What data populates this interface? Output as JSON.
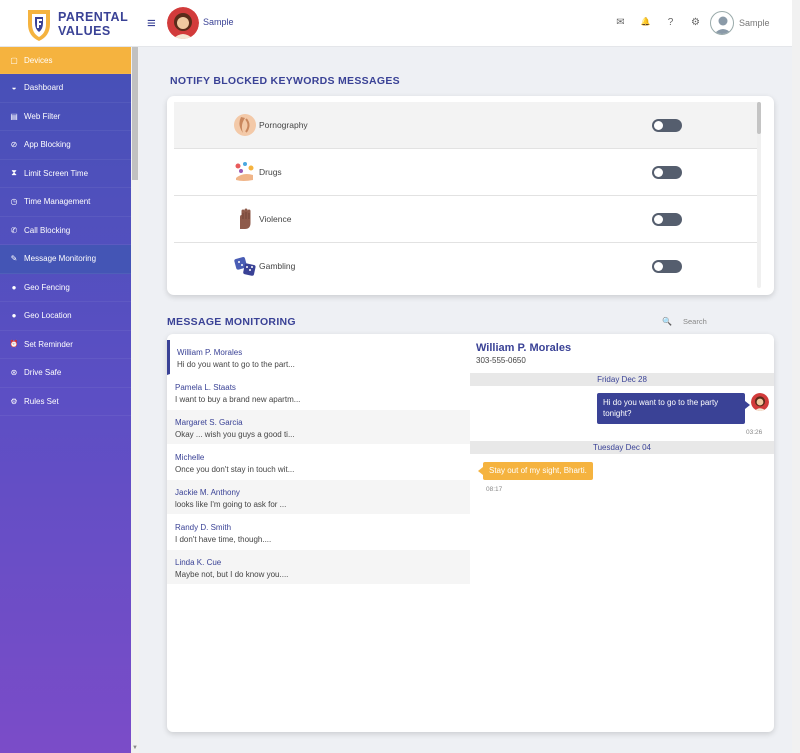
{
  "brand": {
    "line1": "PARENTAL",
    "line2": "VALUES",
    "colors": {
      "primary": "#3a4296",
      "accent": "#f5b33f"
    }
  },
  "header": {
    "menu_icon": "hamburger-icon",
    "profile_name": "Sample",
    "icons": [
      "mail-icon",
      "bell-icon",
      "help-icon",
      "gear-icon"
    ],
    "icon_glyphs": [
      "✉",
      "🔔",
      "?",
      "⚙"
    ],
    "user_name": "Sample"
  },
  "sidebar": {
    "items": [
      {
        "label": "Devices",
        "icon": "device-icon",
        "glyph": "▢"
      },
      {
        "label": "Dashboard",
        "icon": "dashboard-icon",
        "glyph": "◒"
      },
      {
        "label": "Web Filter",
        "icon": "web-filter-icon",
        "glyph": "▤"
      },
      {
        "label": "App Blocking",
        "icon": "block-icon",
        "glyph": "⊘"
      },
      {
        "label": "Limit Screen Time",
        "icon": "hourglass-icon",
        "glyph": "⧗"
      },
      {
        "label": "Time Management",
        "icon": "clock-icon",
        "glyph": "◷"
      },
      {
        "label": "Call Blocking",
        "icon": "phone-icon",
        "glyph": "✆"
      },
      {
        "label": "Message Monitoring",
        "icon": "message-icon",
        "glyph": "✎"
      },
      {
        "label": "Geo Fencing",
        "icon": "globe-icon",
        "glyph": "●"
      },
      {
        "label": "Geo Location",
        "icon": "location-pin-icon",
        "glyph": "●"
      },
      {
        "label": "Set Reminder",
        "icon": "alarm-icon",
        "glyph": "⏰"
      },
      {
        "label": "Drive Safe",
        "icon": "steering-icon",
        "glyph": "⊛"
      },
      {
        "label": "Rules Set",
        "icon": "rules-icon",
        "glyph": "⚙"
      }
    ]
  },
  "keywords": {
    "title": "NOTIFY BLOCKED KEYWORDS MESSAGES",
    "items": [
      {
        "label": "Pornography",
        "icon": "pornography-icon",
        "enabled": false
      },
      {
        "label": "Drugs",
        "icon": "drugs-icon",
        "enabled": false
      },
      {
        "label": "Violence",
        "icon": "violence-hand-icon",
        "enabled": false
      },
      {
        "label": "Gambling",
        "icon": "dice-icon",
        "enabled": false
      }
    ]
  },
  "monitoring": {
    "title": "MESSAGE MONITORING",
    "search_placeholder": "Search",
    "contacts": [
      {
        "name": "William P. Morales",
        "preview": "Hi do you want to go to the part..."
      },
      {
        "name": "Pamela L. Staats",
        "preview": "I want to buy a brand new apartm..."
      },
      {
        "name": "Margaret S. Garcia",
        "preview": "Okay ... wish you guys a good ti..."
      },
      {
        "name": "Michelle",
        "preview": "Once you don't stay in touch wit..."
      },
      {
        "name": "Jackie M. Anthony",
        "preview": "looks like I'm going to ask for ..."
      },
      {
        "name": "Randy D. Smith",
        "preview": "I don't have time, though...."
      },
      {
        "name": "Linda K. Cue",
        "preview": "Maybe not, but I do know you...."
      }
    ],
    "chat": {
      "name": "William P. Morales",
      "phone": "303-555-0650",
      "date1": "Friday Dec 28",
      "out_message": "Hi do you want to go to the party tonight?",
      "out_time": "03:26",
      "date2": "Tuesday Dec 04",
      "in_message": "Stay out of my sight, Bharti.",
      "in_time": "08:17"
    }
  }
}
